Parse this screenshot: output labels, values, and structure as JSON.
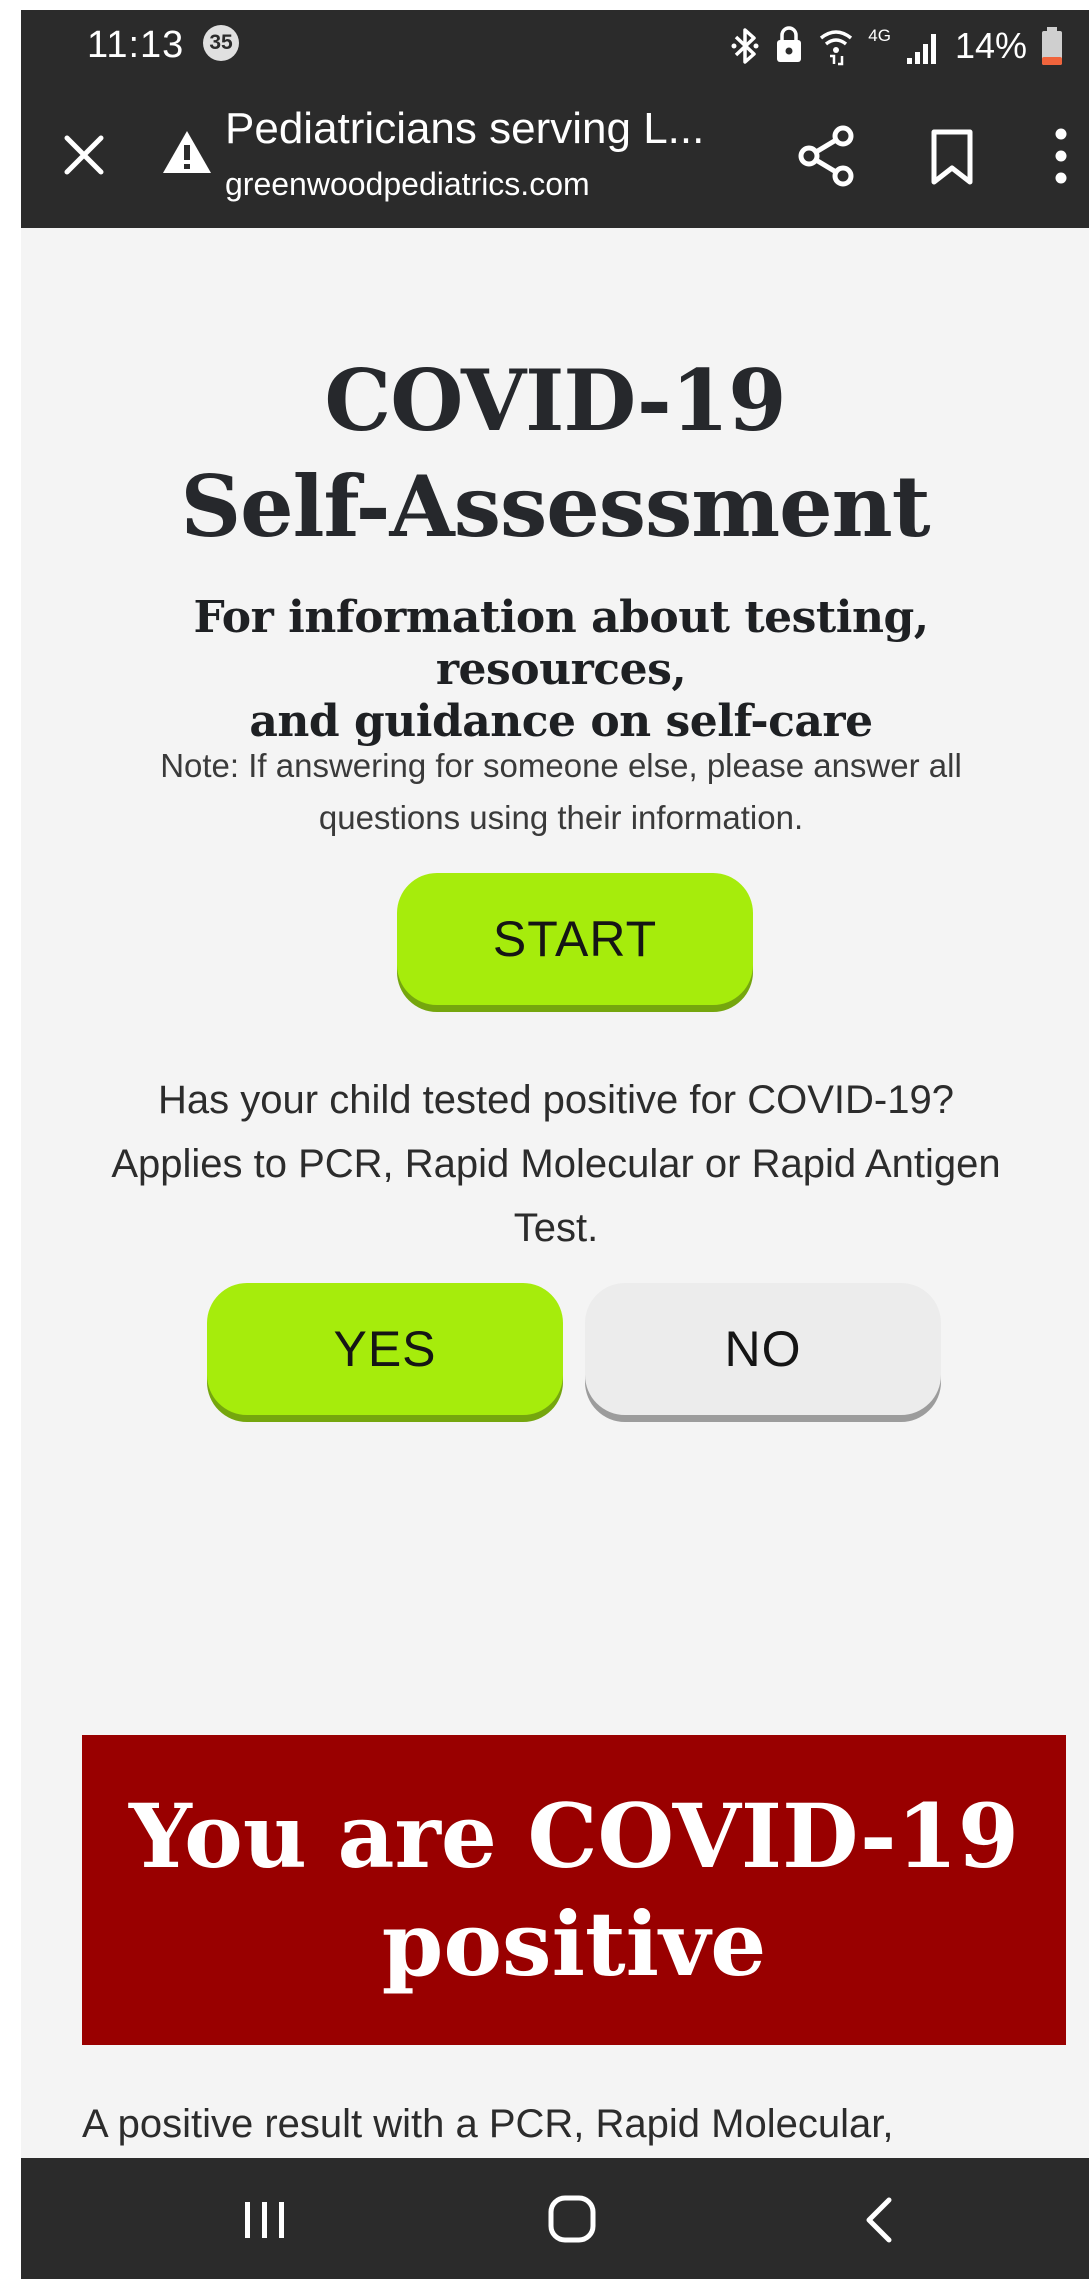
{
  "status_bar": {
    "time": "11:13",
    "notification_count": "35",
    "battery_percent": "14%",
    "network_label": "4G",
    "icons": [
      "bluetooth-icon",
      "lock-icon",
      "wifi-icon",
      "network-4g-icon",
      "signal-icon",
      "battery-icon"
    ]
  },
  "toolbar": {
    "title": "Pediatricians serving L...",
    "url": "greenwoodpediatrics.com",
    "icons": [
      "close-icon",
      "warning-icon",
      "share-icon",
      "bookmark-icon",
      "more-vertical-icon"
    ]
  },
  "page": {
    "heading_line1": "COVID-19",
    "heading_line2": "Self-Assessment",
    "subheading_line1": "For information about testing, resources,",
    "subheading_line2": "and guidance on self-care",
    "note_line1": "Note: If answering for someone else, please answer all",
    "note_line2": "questions using their information.",
    "start_label": "START",
    "question_line1": "Has your child tested positive for COVID-19?",
    "question_line2": "Applies to PCR, Rapid Molecular or Rapid Antigen",
    "question_line3": "Test.",
    "yes_label": "YES",
    "no_label": "NO",
    "result_banner_line1": "You are COVID-19",
    "result_banner_line2": "positive",
    "result_text": "A positive result with a PCR, Rapid Molecular,"
  },
  "colors": {
    "bar_background": "#2b2b2b",
    "page_background": "#f4f4f4",
    "accent_green": "#a6ec0c",
    "no_button": "#ececec",
    "result_red": "#990000",
    "battery_low": "#f0643c"
  },
  "nav_bar": {
    "icons": [
      "recent-apps-icon",
      "home-icon",
      "back-icon"
    ]
  }
}
